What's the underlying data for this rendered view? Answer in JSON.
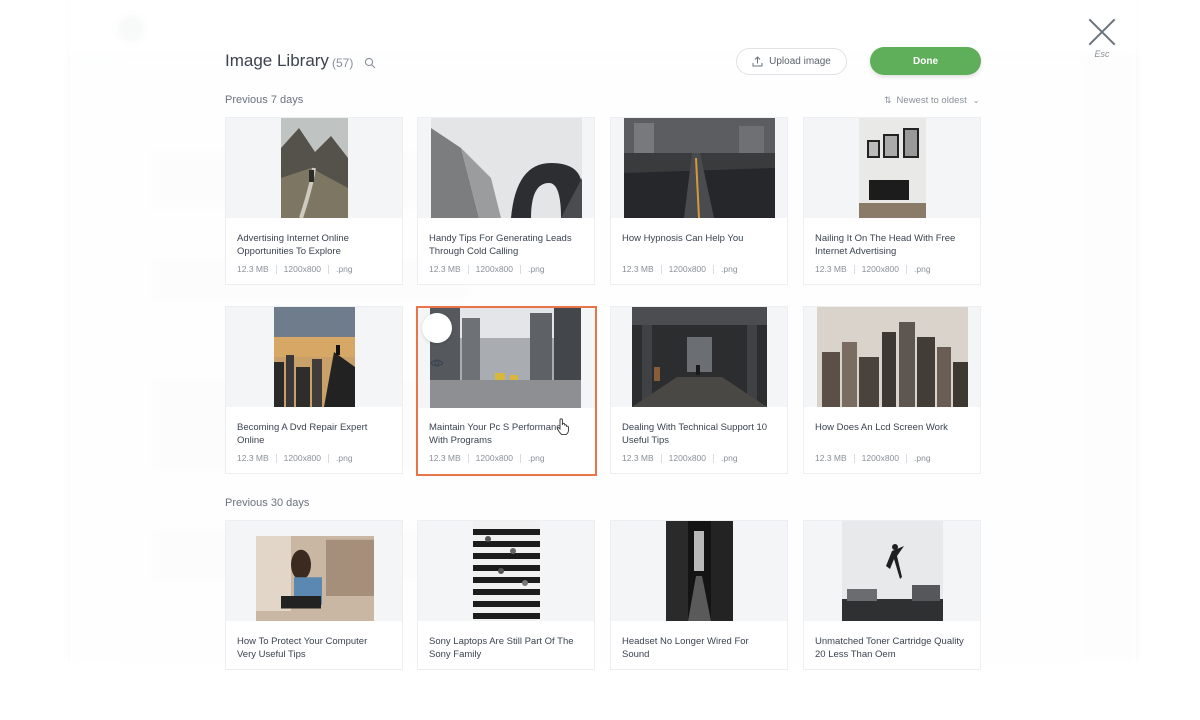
{
  "modal": {
    "title": "Image Library",
    "count": "(57)",
    "upload_label": "Upload image",
    "done_label": "Done",
    "close_hint": "Esc",
    "sort_label": "Newest to oldest"
  },
  "sections": [
    {
      "label": "Previous 7 days",
      "cards": [
        {
          "title": "Advertising Internet Online Opportunities To Explore",
          "size": "12.3 MB",
          "dims": "1200x800",
          "ext": ".png"
        },
        {
          "title": "Handy Tips For Generating Leads Through Cold Calling",
          "size": "12.3 MB",
          "dims": "1200x800",
          "ext": ".png"
        },
        {
          "title": "How Hypnosis Can Help You",
          "size": "12.3 MB",
          "dims": "1200x800",
          "ext": ".png"
        },
        {
          "title": "Nailing It On The Head With Free Internet Advertising",
          "size": "12.3 MB",
          "dims": "1200x800",
          "ext": ".png"
        },
        {
          "title": "Becoming A Dvd Repair Expert Online",
          "size": "12.3 MB",
          "dims": "1200x800",
          "ext": ".png"
        },
        {
          "title": "Maintain Your Pc S Performance With Programs",
          "size": "12.3 MB",
          "dims": "1200x800",
          "ext": ".png",
          "selected": true
        },
        {
          "title": "Dealing With Technical Support 10 Useful Tips",
          "size": "12.3 MB",
          "dims": "1200x800",
          "ext": ".png"
        },
        {
          "title": "How Does An Lcd Screen Work",
          "size": "12.3 MB",
          "dims": "1200x800",
          "ext": ".png"
        }
      ]
    },
    {
      "label": "Previous 30 days",
      "cards": [
        {
          "title": "How To Protect Your Computer Very Useful Tips"
        },
        {
          "title": "Sony Laptops Are Still Part Of The Sony Family"
        },
        {
          "title": "Headset No Longer Wired For Sound"
        },
        {
          "title": "Unmatched Toner Cartridge Quality 20 Less Than Oem"
        }
      ]
    }
  ],
  "colors": {
    "accent_done": "#5fae5a",
    "selected_border": "#e8754a"
  }
}
